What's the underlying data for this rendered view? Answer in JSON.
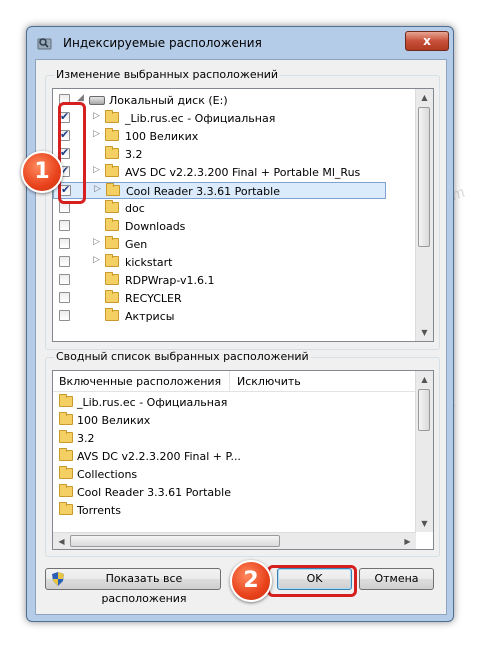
{
  "window": {
    "title": "Индексируемые расположения",
    "close_label": "x"
  },
  "locations_group": {
    "label": "Изменение выбранных расположений",
    "items": [
      {
        "label": "Локальный диск (E:)",
        "checked": false,
        "expander": "◢",
        "icon": "drive-icon"
      },
      {
        "label": "_Lib.rus.ec - Официальная",
        "checked": true,
        "expander": "▷",
        "icon": "folder-icon"
      },
      {
        "label": "100 Великих",
        "checked": true,
        "expander": "▷",
        "icon": "folder-icon"
      },
      {
        "label": "3.2",
        "checked": true,
        "expander": "",
        "icon": "folder-icon"
      },
      {
        "label": "AVS DC v2.2.3.200 Final + Portable Ml_Rus",
        "checked": true,
        "expander": "▷",
        "icon": "folder-icon"
      },
      {
        "label": "Cool Reader 3.3.61 Portable",
        "checked": true,
        "expander": "▷",
        "icon": "folder-icon",
        "selected": true
      },
      {
        "label": "doc",
        "checked": false,
        "expander": "",
        "icon": "folder-icon"
      },
      {
        "label": "Downloads",
        "checked": false,
        "expander": "",
        "icon": "folder-icon"
      },
      {
        "label": "Gen",
        "checked": false,
        "expander": "▷",
        "icon": "folder-icon"
      },
      {
        "label": "kickstart",
        "checked": false,
        "expander": "▷",
        "icon": "folder-icon"
      },
      {
        "label": "RDPWrap-v1.6.1",
        "checked": false,
        "expander": "",
        "icon": "folder-icon"
      },
      {
        "label": "RECYCLER",
        "checked": false,
        "expander": "",
        "icon": "folder-icon"
      },
      {
        "label": "Актрисы",
        "checked": false,
        "expander": "",
        "icon": "folder-icon"
      }
    ]
  },
  "summary_group": {
    "label": "Сводный список выбранных расположений",
    "columns": [
      "Включенные расположения",
      "Исключить"
    ],
    "rows": [
      "_Lib.rus.ec - Официальная",
      "100 Великих",
      "3.2",
      "AVS DC v2.2.3.200 Final + P...",
      "Collections",
      "Cool Reader 3.3.61 Portable",
      "Torrents"
    ]
  },
  "buttons": {
    "show_all": "Показать все расположения",
    "ok": "OK",
    "cancel": "Отмена"
  },
  "callouts": {
    "step1": "1",
    "step2": "2"
  },
  "colors": {
    "highlight": "#d61f1f",
    "badge": "#e8421c",
    "selection": "#dcebfc"
  }
}
